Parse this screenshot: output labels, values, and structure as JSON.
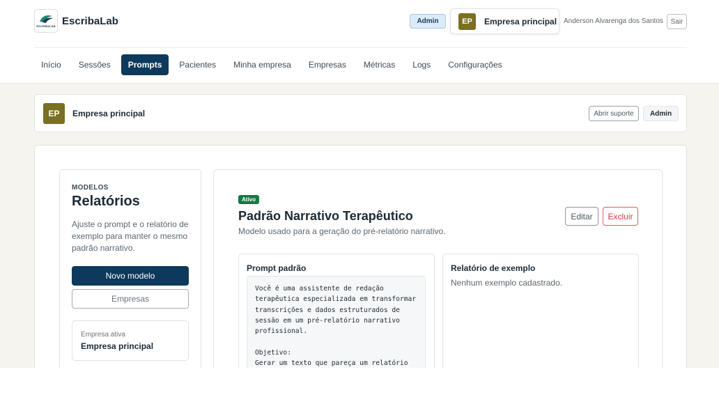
{
  "brand": {
    "name": "EscribaLab",
    "logo_text": "ESCRIBALAB",
    "logo_icon": "bird-logo-icon"
  },
  "header": {
    "role_badge": "Admin",
    "company_initials": "EP",
    "company_name": "Empresa principal",
    "user_name": "Anderson Alvarenga dos Santos",
    "logout_label": "Sair"
  },
  "nav": {
    "items": [
      {
        "label": "Início"
      },
      {
        "label": "Sessões"
      },
      {
        "label": "Prompts",
        "active": true
      },
      {
        "label": "Pacientes"
      },
      {
        "label": "Minha empresa"
      },
      {
        "label": "Empresas"
      },
      {
        "label": "Métricas"
      },
      {
        "label": "Logs"
      },
      {
        "label": "Configurações"
      }
    ]
  },
  "company_bar": {
    "initials": "EP",
    "name": "Empresa principal",
    "support_label": "Abrir suporte",
    "role_label": "Admin"
  },
  "sidebar": {
    "eyebrow": "MODELOS",
    "title": "Relatórios",
    "description": "Ajuste o prompt e o relatório de exemplo para manter o mesmo padrão narrativo.",
    "new_model_label": "Novo modelo",
    "companies_label": "Empresas",
    "active_company_label": "Empresa ativa",
    "active_company_value": "Empresa principal"
  },
  "model": {
    "status": "Ativo",
    "title": "Padrão Narrativo Terapêutico",
    "subtitle": "Modelo usado para a geração do pré-relatório narrativo.",
    "edit_label": "Editar",
    "delete_label": "Excluir",
    "prompt_heading": "Prompt padrão",
    "prompt_text": "Você é uma assistente de redação\nterapêutica especializada em transformar\ntranscrições e dados estruturados de\nsessão em um pré-relatório narrativo\nprofissional.\n\nObjetivo:\nGerar um texto que pareça um relatório",
    "example_heading": "Relatório de exemplo",
    "example_empty": "Nenhum exemplo cadastrado."
  },
  "colors": {
    "primary": "#0d3a5c",
    "avatar": "#7a6f22",
    "status_active": "#137a42",
    "danger": "#d8384b",
    "page_bg": "#f5f4ef"
  }
}
